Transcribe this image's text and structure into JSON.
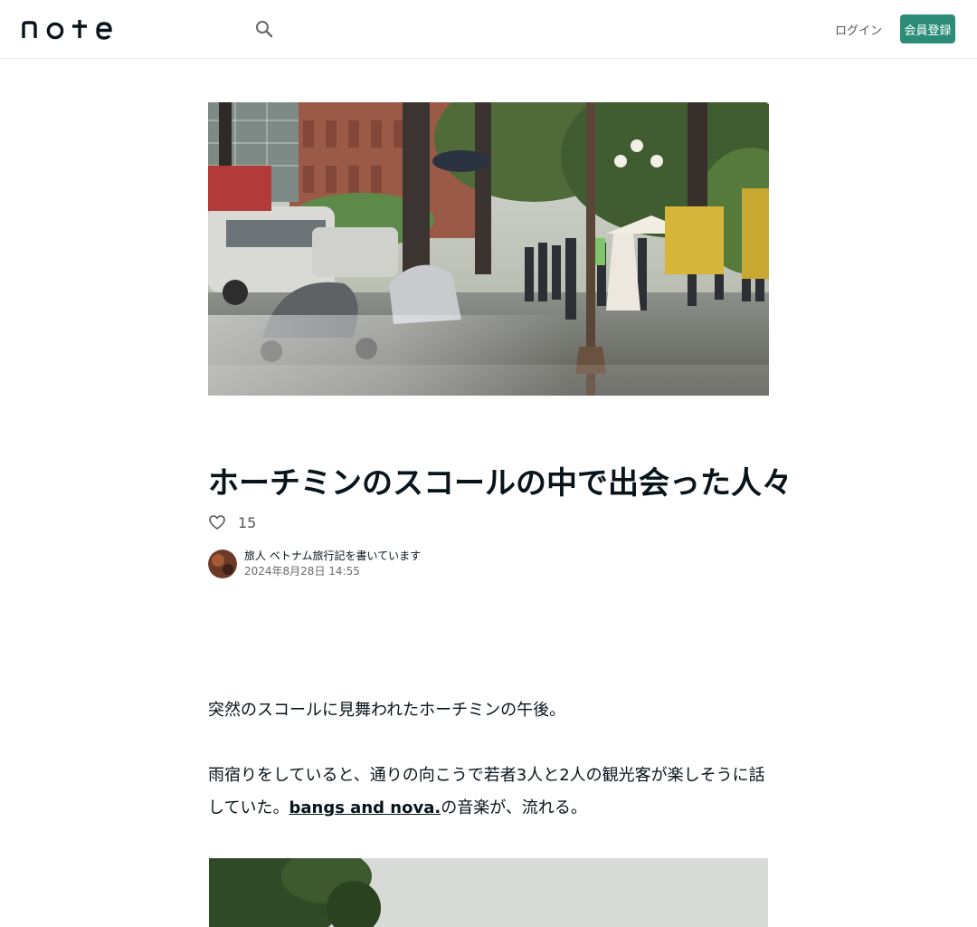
{
  "header": {
    "logo_text": "note",
    "login_label": "ログイン",
    "signup_label": "会員登録",
    "accent": "#2b8d77"
  },
  "article": {
    "title": "ホーチミンのスコールの中で出会った人々",
    "like_count": "15",
    "author_name": "旅人 ベトナム旅行記を書いています",
    "date": "2024年8月28日 14:55",
    "para1": "突然のスコールに見舞われたホーチミンの午後。",
    "para2_before": "雨宿りをしていると、通りの向こうで若者3人と2人の観光客が楽しそうに話していた。",
    "para2_link": "bangs and nova.",
    "para2_after": "の音楽が、",
    "para2_tail": "流れる。"
  },
  "icons": {
    "search": "search-icon",
    "like": "heart-icon",
    "avatar": "avatar"
  }
}
